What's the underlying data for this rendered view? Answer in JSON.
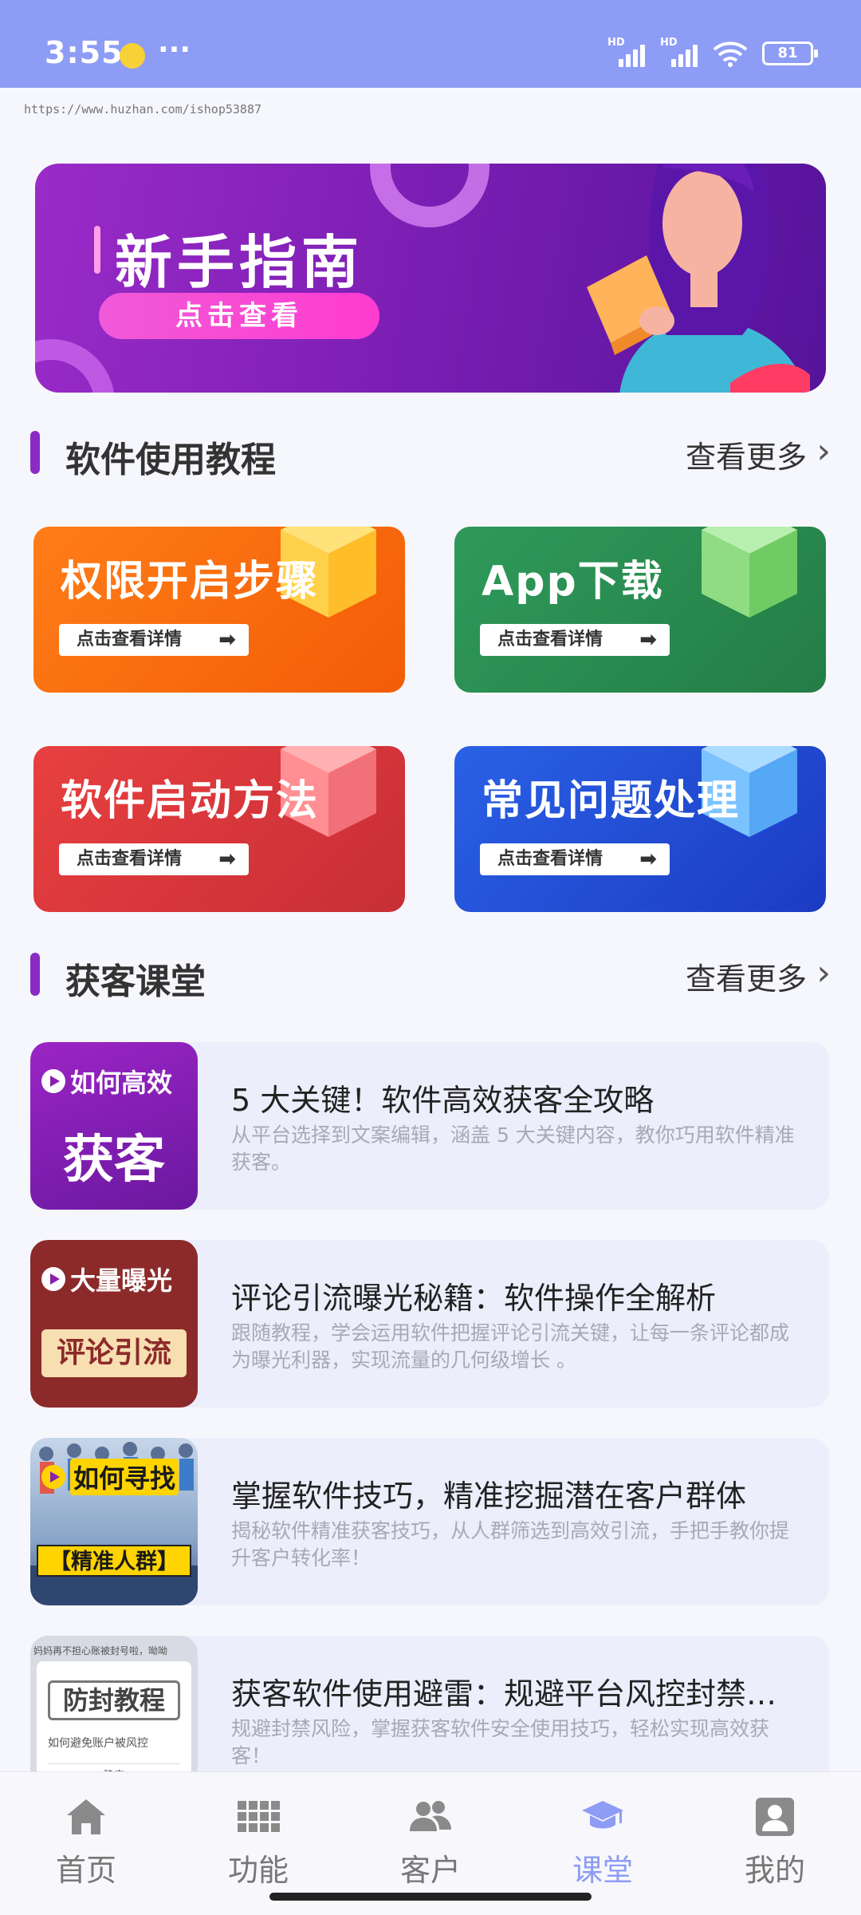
{
  "status_bar": {
    "time": "3:55",
    "signal1_label": "HD",
    "signal2_label": "HD",
    "battery": "81",
    "more_dots": "···"
  },
  "watermark_url": "https://www.huzhan.com/ishop53887",
  "hero": {
    "title": "新手指南",
    "button": "点击查看"
  },
  "tutorial_section": {
    "title": "软件使用教程",
    "more": "查看更多"
  },
  "tutorial_cards": [
    {
      "title": "权限开启步骤",
      "link": "点击查看详情"
    },
    {
      "title": "App下载",
      "link": "点击查看详情"
    },
    {
      "title": "软件启动方法",
      "link": "点击查看详情"
    },
    {
      "title": "常见问题处理",
      "link": "点击查看详情"
    }
  ],
  "class_section": {
    "title": "获客课堂",
    "more": "查看更多"
  },
  "courses": [
    {
      "thumb_top": "如何高效",
      "thumb_main": "获客",
      "title": "5 大关键！软件高效获客全攻略",
      "desc": "从平台选择到文案编辑，涵盖 5 大关键内容，教你巧用软件精准获客。"
    },
    {
      "thumb_top": "大量曝光",
      "thumb_main": "评论引流",
      "title": "评论引流曝光秘籍：软件操作全解析",
      "desc": "跟随教程，学会运用软件把握评论引流关键，让每一条评论都成为曝光利器，实现流量的几何级增长 。"
    },
    {
      "thumb_top": "如何寻找",
      "thumb_main": "【精准人群】",
      "title": "掌握软件技巧，精准挖掘潜在客户群体",
      "desc": "揭秘软件精准获客技巧，从人群筛选到高效引流，手把手教你提升客户转化率！"
    },
    {
      "thumb_top": "妈妈再不担心账被封号啦，呦呦",
      "thumb_main": "防封教程",
      "thumb_sub": "如何避免账户被风控",
      "thumb_btn": "确定",
      "title": "获客软件使用避雷：规避平台风控封禁…",
      "desc": "规避封禁风险，掌握获客软件安全使用技巧，轻松实现高效获客！"
    }
  ],
  "bottom_nav": [
    {
      "label": "首页",
      "icon": "home-icon"
    },
    {
      "label": "功能",
      "icon": "grid-icon"
    },
    {
      "label": "客户",
      "icon": "users-icon"
    },
    {
      "label": "课堂",
      "icon": "graduation-cap-icon",
      "active": true
    },
    {
      "label": "我的",
      "icon": "profile-icon"
    }
  ],
  "colors": {
    "status_bar": "#8d9cf5",
    "accent_purple": "#8a2cc4",
    "nav_active": "#8d9cf5"
  }
}
